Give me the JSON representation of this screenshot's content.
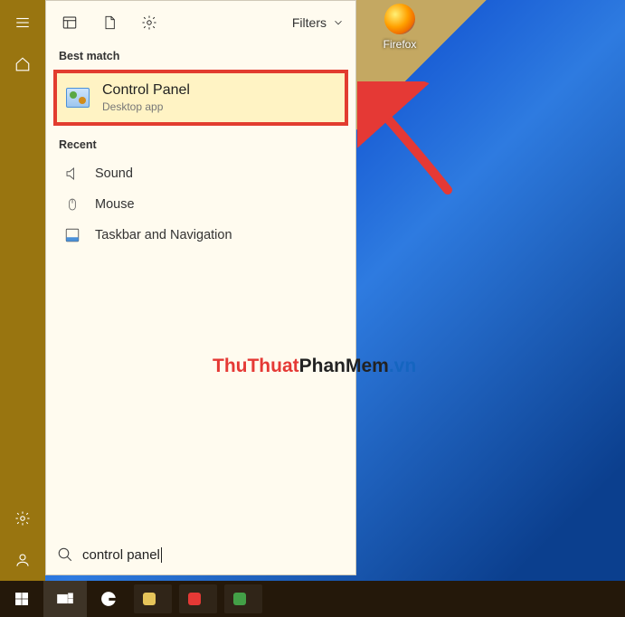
{
  "rail": {
    "items": [
      "menu",
      "home",
      "gear",
      "user"
    ]
  },
  "panel": {
    "filters_label": "Filters",
    "section_best": "Best match",
    "selected": {
      "title": "Control Panel",
      "subtitle": "Desktop app"
    },
    "section_recent": "Recent",
    "recent": [
      {
        "label": "Sound"
      },
      {
        "label": "Mouse"
      },
      {
        "label": "Taskbar and Navigation"
      }
    ]
  },
  "search": {
    "query": "control panel"
  },
  "desktop": {
    "firefox_label": "Firefox"
  },
  "watermark": {
    "a": "ThuThuat",
    "b": "PhanMem",
    "c": ".vn"
  },
  "taskbar": {
    "items": [
      "",
      "",
      ""
    ]
  }
}
